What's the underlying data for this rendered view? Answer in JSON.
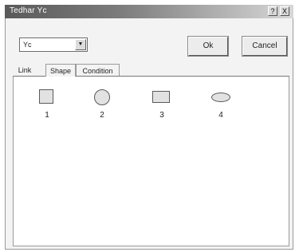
{
  "window": {
    "title": "Tedhar Yc",
    "help_label": "?",
    "close_label": "X"
  },
  "combo": {
    "value": "Yc"
  },
  "buttons": {
    "ok_label": "Ok",
    "cancel_label": "Cancel"
  },
  "tabs": [
    {
      "label": "Link",
      "active": false
    },
    {
      "label": "Shape",
      "active": true
    },
    {
      "label": "Condition",
      "active": false
    }
  ],
  "shapes": [
    {
      "label": "1",
      "icon": "square-shape-icon"
    },
    {
      "label": "2",
      "icon": "circle-shape-icon"
    },
    {
      "label": "3",
      "icon": "rectangle-shape-icon"
    },
    {
      "label": "4",
      "icon": "ellipse-shape-icon"
    }
  ],
  "colors": {
    "titlebar_start": "#5a5a5a",
    "titlebar_end": "#d8d8d8",
    "panel_bg": "#ffffff"
  }
}
